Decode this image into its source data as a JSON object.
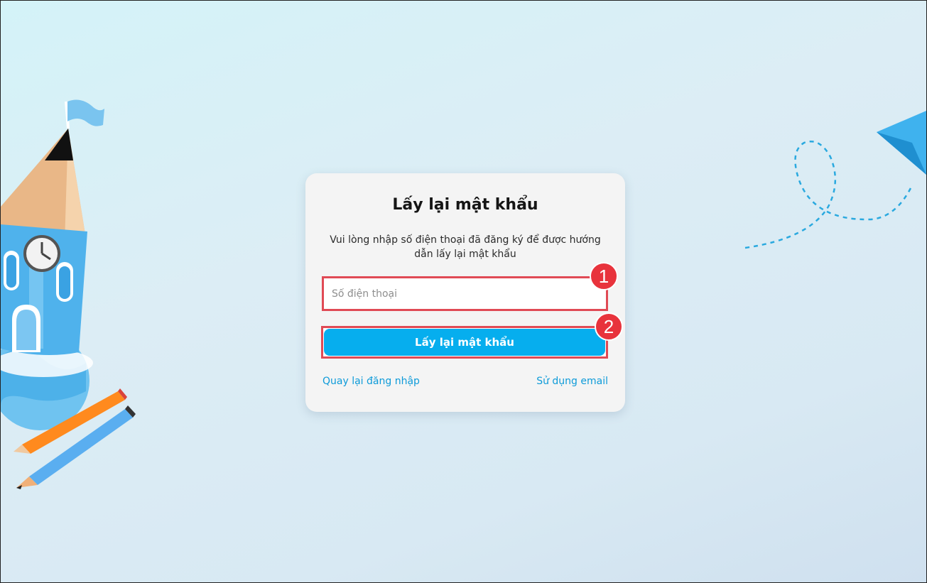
{
  "title": "Lấy lại mật khẩu",
  "description": "Vui lòng nhập số điện thoại đã đăng ký để được hướng dẫn lấy lại mật khẩu",
  "phone_input": {
    "value": "",
    "placeholder": "Số điện thoại"
  },
  "submit_label": "Lấy lại mật khẩu",
  "back_link": "Quay lại đăng nhập",
  "email_link": "Sử dụng email",
  "badges": [
    "1",
    "2"
  ],
  "colors": {
    "accent": "#06aeee",
    "link": "#0e9bd9",
    "highlight": "#e04a55",
    "badge": "#e8333c"
  },
  "decor_icons": [
    "pencil-castle-icon",
    "globe-icon",
    "pencils-icon",
    "paper-plane-icon"
  ]
}
